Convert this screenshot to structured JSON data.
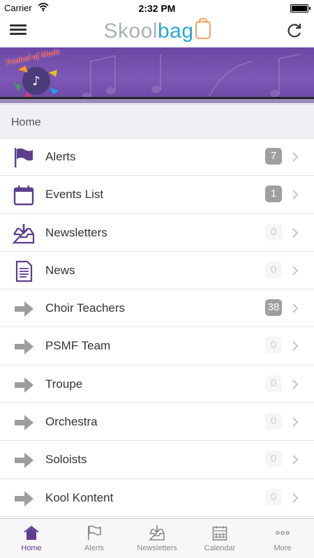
{
  "status_bar": {
    "carrier": "Carrier",
    "time": "2:32 PM"
  },
  "header": {
    "logo_part1": "Skool",
    "logo_part2": "bag"
  },
  "banner": {
    "logo_text": "Festival of Music"
  },
  "section": {
    "title": "Home"
  },
  "items": [
    {
      "label": "Alerts",
      "count": "7",
      "icon": "flag-icon",
      "zero": false
    },
    {
      "label": "Events List",
      "count": "1",
      "icon": "calendar-icon",
      "zero": false
    },
    {
      "label": "Newsletters",
      "count": "0",
      "icon": "download-tray-icon",
      "zero": true
    },
    {
      "label": "News",
      "count": "0",
      "icon": "document-icon",
      "zero": true
    },
    {
      "label": "Choir Teachers",
      "count": "38",
      "icon": "arrow-right-icon",
      "zero": false
    },
    {
      "label": "PSMF Team",
      "count": "0",
      "icon": "arrow-right-icon",
      "zero": true
    },
    {
      "label": "Troupe",
      "count": "0",
      "icon": "arrow-right-icon",
      "zero": true
    },
    {
      "label": "Orchestra",
      "count": "0",
      "icon": "arrow-right-icon",
      "zero": true
    },
    {
      "label": "Soloists",
      "count": "0",
      "icon": "arrow-right-icon",
      "zero": true
    },
    {
      "label": "Kool Kontent",
      "count": "0",
      "icon": "arrow-right-icon",
      "zero": true
    }
  ],
  "tabs": [
    {
      "label": "Home",
      "icon": "home-icon",
      "active": true
    },
    {
      "label": "Alerts",
      "icon": "flag-icon",
      "active": false
    },
    {
      "label": "Newsletters",
      "icon": "download-tray-icon",
      "active": false
    },
    {
      "label": "Calendar",
      "icon": "calendar-icon",
      "active": false
    },
    {
      "label": "More",
      "icon": "more-dots-icon",
      "active": false
    }
  ],
  "colors": {
    "accent": "#5f3d8e",
    "banner": "#7352a8",
    "badge_active": "#9f9f9f",
    "badge_zero": "#f6f6f6",
    "arrow_gray": "#9d9d9d"
  }
}
